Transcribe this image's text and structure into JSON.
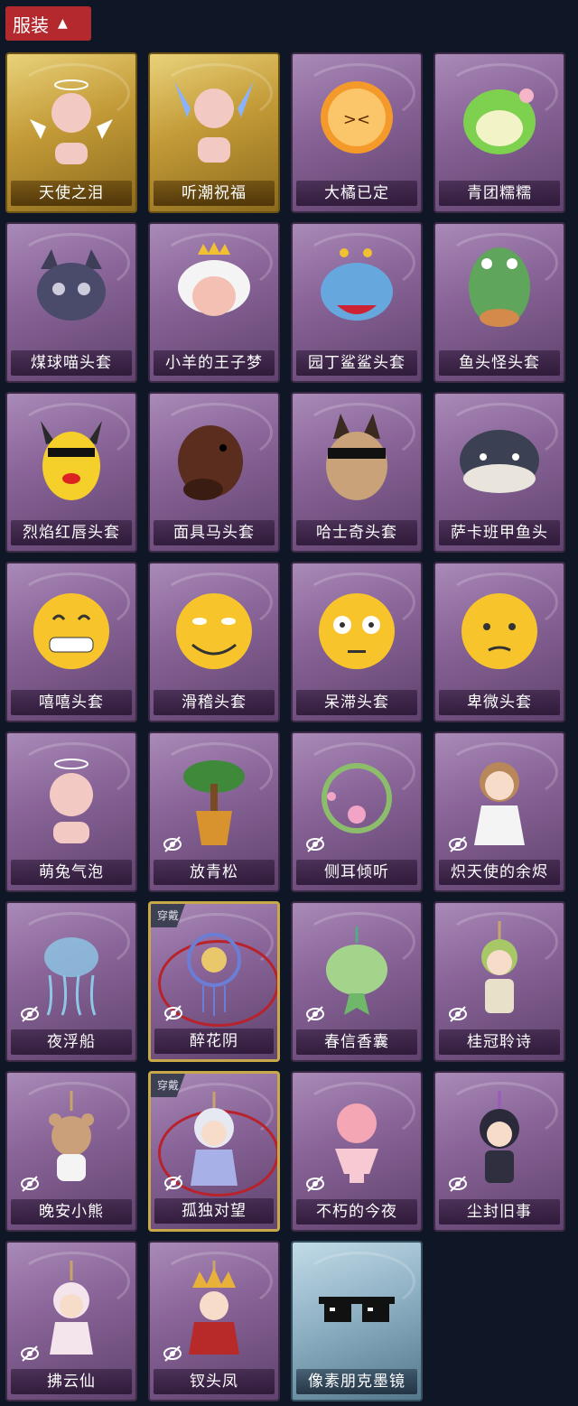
{
  "header": {
    "title": "服装"
  },
  "items": [
    {
      "label": "天使之泪",
      "style": "gold",
      "hidden_icon": false,
      "worn": false,
      "art": "angel-halo"
    },
    {
      "label": "听潮祝福",
      "style": "gold",
      "hidden_icon": false,
      "worn": false,
      "art": "blue-wings"
    },
    {
      "label": "大橘已定",
      "style": "purple",
      "hidden_icon": false,
      "worn": false,
      "art": "orange-slice"
    },
    {
      "label": "青团糯糯",
      "style": "purple",
      "hidden_icon": false,
      "worn": false,
      "art": "green-mochi"
    },
    {
      "label": "煤球喵头套",
      "style": "purple",
      "hidden_icon": false,
      "worn": false,
      "art": "cat-head"
    },
    {
      "label": "小羊的王子梦",
      "style": "purple",
      "hidden_icon": false,
      "worn": false,
      "art": "sheep-crown"
    },
    {
      "label": "园丁鲨鲨头套",
      "style": "purple",
      "hidden_icon": false,
      "worn": false,
      "art": "shark-head"
    },
    {
      "label": "鱼头怪头套",
      "style": "purple",
      "hidden_icon": false,
      "worn": false,
      "art": "fish-head"
    },
    {
      "label": "烈焰红唇头套",
      "style": "purple",
      "hidden_icon": false,
      "worn": false,
      "art": "yellow-mouse"
    },
    {
      "label": "面具马头套",
      "style": "purple",
      "hidden_icon": false,
      "worn": false,
      "art": "horse-head"
    },
    {
      "label": "哈士奇头套",
      "style": "purple",
      "hidden_icon": false,
      "worn": false,
      "art": "dog-head"
    },
    {
      "label": "萨卡班甲鱼头",
      "style": "purple",
      "hidden_icon": false,
      "worn": false,
      "art": "blob-fish"
    },
    {
      "label": "嘻嘻头套",
      "style": "purple",
      "hidden_icon": false,
      "worn": false,
      "art": "grin-emoji"
    },
    {
      "label": "滑稽头套",
      "style": "purple",
      "hidden_icon": false,
      "worn": false,
      "art": "smirk-emoji"
    },
    {
      "label": "呆滞头套",
      "style": "purple",
      "hidden_icon": false,
      "worn": false,
      "art": "stare-emoji"
    },
    {
      "label": "卑微头套",
      "style": "purple",
      "hidden_icon": false,
      "worn": false,
      "art": "sad-emoji"
    },
    {
      "label": "萌兔气泡",
      "style": "purple",
      "hidden_icon": false,
      "worn": false,
      "art": "bunny-bubble"
    },
    {
      "label": "放青松",
      "style": "purple",
      "hidden_icon": true,
      "worn": false,
      "art": "bonsai"
    },
    {
      "label": "侧耳倾听",
      "style": "purple",
      "hidden_icon": true,
      "worn": false,
      "art": "flower-wreath"
    },
    {
      "label": "炽天使的余烬",
      "style": "purple",
      "hidden_icon": true,
      "worn": false,
      "art": "angel-doll"
    },
    {
      "label": "夜浮船",
      "style": "purple",
      "hidden_icon": true,
      "worn": false,
      "art": "jellyfish"
    },
    {
      "label": "醉花阴",
      "style": "purple",
      "hidden_icon": true,
      "worn": true,
      "art": "dreamcatcher"
    },
    {
      "label": "春信香囊",
      "style": "purple",
      "hidden_icon": true,
      "worn": false,
      "art": "sachet"
    },
    {
      "label": "桂冠聆诗",
      "style": "purple",
      "hidden_icon": true,
      "worn": false,
      "art": "laurel-doll"
    },
    {
      "label": "晚安小熊",
      "style": "purple",
      "hidden_icon": true,
      "worn": false,
      "art": "bear-charm"
    },
    {
      "label": "孤独对望",
      "style": "purple",
      "hidden_icon": true,
      "worn": true,
      "art": "silver-doll"
    },
    {
      "label": "不朽的今夜",
      "style": "purple",
      "hidden_icon": true,
      "worn": false,
      "art": "fox-bowl"
    },
    {
      "label": "尘封旧事",
      "style": "purple",
      "hidden_icon": true,
      "worn": false,
      "art": "dark-doll"
    },
    {
      "label": "拂云仙",
      "style": "purple",
      "hidden_icon": true,
      "worn": false,
      "art": "fairy-charm"
    },
    {
      "label": "钗头凤",
      "style": "purple",
      "hidden_icon": true,
      "worn": false,
      "art": "crown-doll"
    },
    {
      "label": "像素朋克墨镜",
      "style": "blue",
      "hidden_icon": false,
      "worn": false,
      "art": "pixel-glasses"
    }
  ],
  "worn_badge_text": "穿戴"
}
